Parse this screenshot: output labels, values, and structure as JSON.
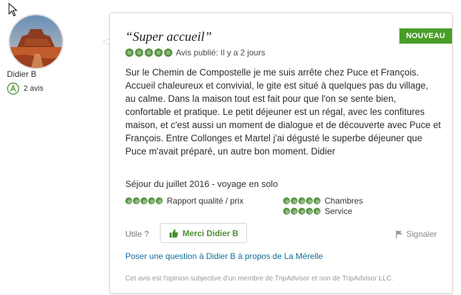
{
  "reviewer": {
    "name": "Didier B",
    "review_count": "2 avis"
  },
  "badge": {
    "label": "NOUVEAU"
  },
  "review": {
    "title": "“Super accueil”",
    "rating": 5,
    "published": "Avis publié: Il y a 2 jours",
    "body": "Sur le Chemin de Compostelle je me suis arrête chez Puce et François. Accueil chaleureux et convivial, le gite est situé à quelques pas du village, au calme. Dans la maison tout est fait pour que l'on se sente bien, confortable et pratique. Le petit déjeuner est un régal, avec les confitures maison, et c'est aussi un moment de dialogue et de découverte avec Puce et François. Entre Collonges et Martel j'ai dégusté le superbe déjeuner que Puce m'avait préparé, un autre bon moment. Didier",
    "stay": "Séjour du juillet 2016 - voyage en solo"
  },
  "sub_ratings": [
    {
      "label": "Rapport qualité / prix",
      "rating": 5
    },
    {
      "label": "Chambres",
      "rating": 5
    },
    {
      "label": "Service",
      "rating": 5
    }
  ],
  "actions": {
    "utile": "Utile ?",
    "thanks": "Merci Didier B",
    "report": "Signaler",
    "question": "Poser une question à Didier B à propos de La Mérelle"
  },
  "disclaimer": "Cet avis est l'opinion subjective d'un membre de TripAdvisor et non de TripAdvisor LLC.",
  "colors": {
    "accent_green": "#589442",
    "badge_green": "#4a9d27",
    "link_blue": "#0f6d99"
  },
  "icons": [
    "cursor-icon",
    "thumbs-up-icon",
    "flag-icon",
    "reviewer-badge-icon"
  ]
}
